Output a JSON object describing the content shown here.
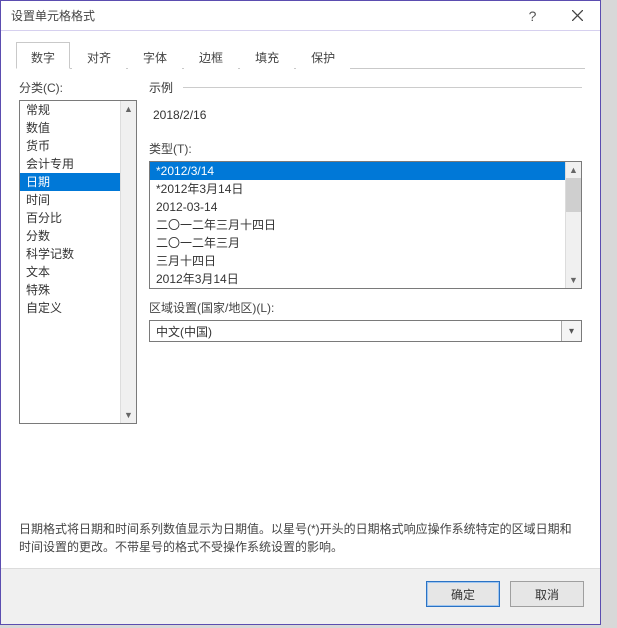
{
  "title": "设置单元格格式",
  "tabs": [
    "数字",
    "对齐",
    "字体",
    "边框",
    "填充",
    "保护"
  ],
  "active_tab_index": 0,
  "category_label": "分类(C):",
  "categories": [
    "常规",
    "数值",
    "货币",
    "会计专用",
    "日期",
    "时间",
    "百分比",
    "分数",
    "科学记数",
    "文本",
    "特殊",
    "自定义"
  ],
  "selected_category_index": 4,
  "sample_label": "示例",
  "sample_value": "2018/2/16",
  "type_label": "类型(T):",
  "types": [
    "*2012/3/14",
    "*2012年3月14日",
    "2012-03-14",
    "二〇一二年三月十四日",
    "二〇一二年三月",
    "三月十四日",
    "2012年3月14日"
  ],
  "selected_type_index": 0,
  "locale_label": "区域设置(国家/地区)(L):",
  "locale_value": "中文(中国)",
  "description": "日期格式将日期和时间系列数值显示为日期值。以星号(*)开头的日期格式响应操作系统特定的区域日期和时间设置的更改。不带星号的格式不受操作系统设置的影响。",
  "ok_label": "确定",
  "cancel_label": "取消"
}
